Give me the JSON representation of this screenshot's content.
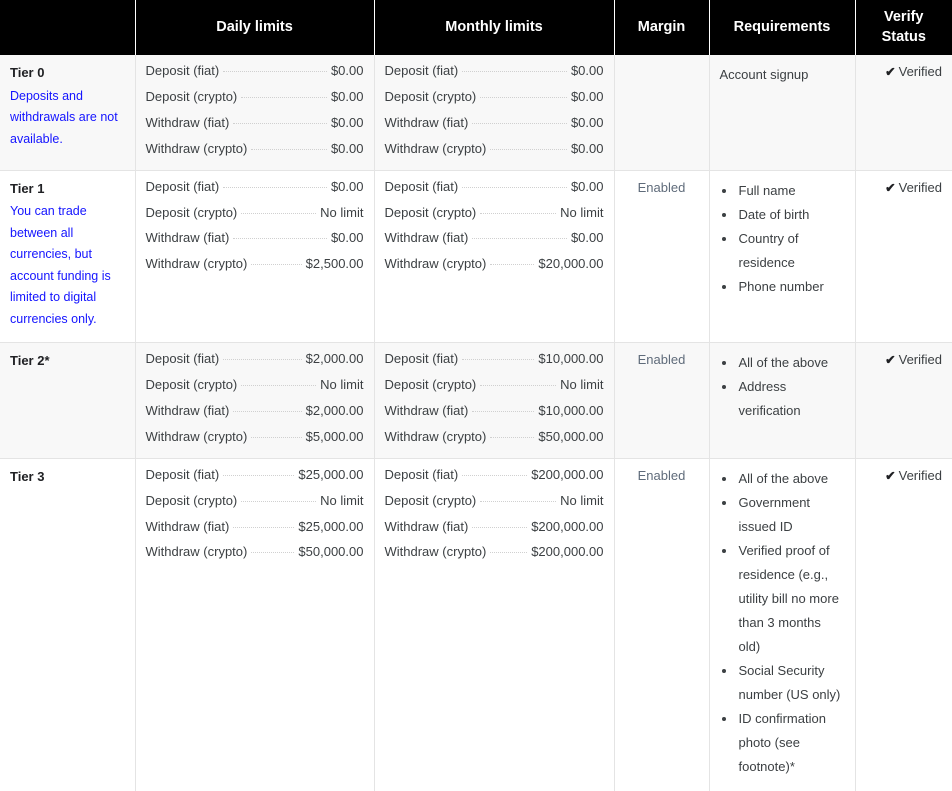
{
  "table": {
    "headers": {
      "tier": "",
      "daily": "Daily limits",
      "monthly": "Monthly limits",
      "margin": "Margin",
      "requirements": "Requirements",
      "verify": "Verify Status"
    },
    "verify_icon": "✔",
    "rows": [
      {
        "tier_name": "Tier 0",
        "tier_desc": "Deposits and withdrawals are not available.",
        "shaded": true,
        "daily": [
          {
            "label": "Deposit (fiat)",
            "value": "$0.00"
          },
          {
            "label": "Deposit (crypto)",
            "value": "$0.00"
          },
          {
            "label": "Withdraw (fiat)",
            "value": "$0.00"
          },
          {
            "label": "Withdraw (crypto)",
            "value": "$0.00"
          }
        ],
        "monthly": [
          {
            "label": "Deposit (fiat)",
            "value": "$0.00"
          },
          {
            "label": "Deposit (crypto)",
            "value": "$0.00"
          },
          {
            "label": "Withdraw (fiat)",
            "value": "$0.00"
          },
          {
            "label": "Withdraw (crypto)",
            "value": "$0.00"
          }
        ],
        "margin": "",
        "requirements_plain": "Account signup",
        "requirements": [],
        "verify": "Verified"
      },
      {
        "tier_name": "Tier 1",
        "tier_desc": "You can trade between all currencies, but account funding is limited to digital currencies only.",
        "shaded": false,
        "daily": [
          {
            "label": "Deposit (fiat)",
            "value": "$0.00"
          },
          {
            "label": "Deposit (crypto)",
            "value": "No limit"
          },
          {
            "label": "Withdraw (fiat)",
            "value": "$0.00"
          },
          {
            "label": "Withdraw (crypto)",
            "value": "$2,500.00"
          }
        ],
        "monthly": [
          {
            "label": "Deposit (fiat)",
            "value": "$0.00"
          },
          {
            "label": "Deposit (crypto)",
            "value": "No limit"
          },
          {
            "label": "Withdraw (fiat)",
            "value": "$0.00"
          },
          {
            "label": "Withdraw (crypto)",
            "value": "$20,000.00"
          }
        ],
        "margin": "Enabled",
        "requirements_plain": "",
        "requirements": [
          "Full name",
          "Date of birth",
          "Country of residence",
          "Phone number"
        ],
        "verify": "Verified"
      },
      {
        "tier_name": "Tier 2*",
        "tier_desc": "",
        "shaded": true,
        "daily": [
          {
            "label": "Deposit (fiat)",
            "value": "$2,000.00"
          },
          {
            "label": "Deposit (crypto)",
            "value": "No limit"
          },
          {
            "label": "Withdraw (fiat)",
            "value": "$2,000.00"
          },
          {
            "label": "Withdraw (crypto)",
            "value": "$5,000.00"
          }
        ],
        "monthly": [
          {
            "label": "Deposit (fiat)",
            "value": "$10,000.00"
          },
          {
            "label": "Deposit (crypto)",
            "value": "No limit"
          },
          {
            "label": "Withdraw (fiat)",
            "value": "$10,000.00"
          },
          {
            "label": "Withdraw (crypto)",
            "value": "$50,000.00"
          }
        ],
        "margin": "Enabled",
        "requirements_plain": "",
        "requirements": [
          "All of the above",
          "Address verification"
        ],
        "verify": "Verified"
      },
      {
        "tier_name": "Tier 3",
        "tier_desc": "",
        "shaded": false,
        "daily": [
          {
            "label": "Deposit (fiat)",
            "value": "$25,000.00"
          },
          {
            "label": "Deposit (crypto)",
            "value": "No limit"
          },
          {
            "label": "Withdraw (fiat)",
            "value": "$25,000.00"
          },
          {
            "label": "Withdraw (crypto)",
            "value": "$50,000.00"
          }
        ],
        "monthly": [
          {
            "label": "Deposit (fiat)",
            "value": "$200,000.00"
          },
          {
            "label": "Deposit (crypto)",
            "value": "No limit"
          },
          {
            "label": "Withdraw (fiat)",
            "value": "$200,000.00"
          },
          {
            "label": "Withdraw (crypto)",
            "value": "$200,000.00"
          }
        ],
        "margin": "Enabled",
        "requirements_plain": "",
        "requirements": [
          "All of the above",
          "Government issued ID",
          "Verified proof of residence (e.g., utility bill no more than 3 months old)",
          "Social Security number (US only)",
          "ID confirmation photo (see footnote)*"
        ],
        "verify": "Verified"
      }
    ]
  },
  "colors": {
    "header_bg": "#000000",
    "header_fg": "#ffffff",
    "desc_blue": "#1414ff",
    "shaded_row": "#f8f8f8",
    "margin_gray": "#5f6b7a"
  }
}
